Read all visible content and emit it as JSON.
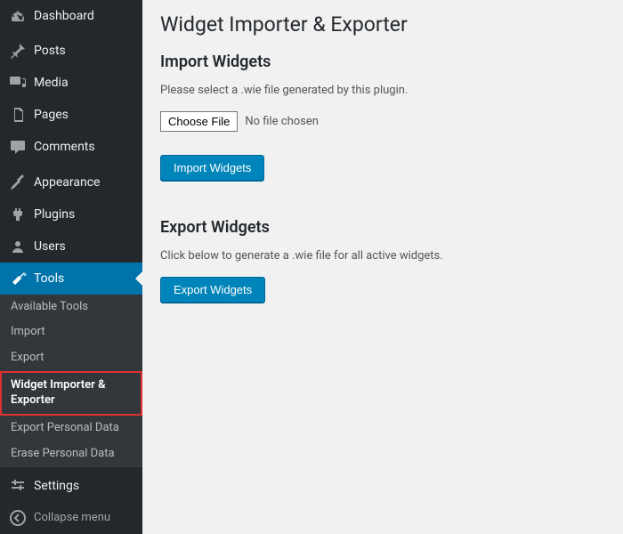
{
  "sidebar": {
    "items": [
      {
        "label": "Dashboard"
      },
      {
        "label": "Posts"
      },
      {
        "label": "Media"
      },
      {
        "label": "Pages"
      },
      {
        "label": "Comments"
      },
      {
        "label": "Appearance"
      },
      {
        "label": "Plugins"
      },
      {
        "label": "Users"
      },
      {
        "label": "Tools"
      },
      {
        "label": "Settings"
      }
    ],
    "tools_submenu": [
      {
        "label": "Available Tools"
      },
      {
        "label": "Import"
      },
      {
        "label": "Export"
      },
      {
        "label": "Widget Importer & Exporter"
      },
      {
        "label": "Export Personal Data"
      },
      {
        "label": "Erase Personal Data"
      }
    ],
    "collapse_label": "Collapse menu"
  },
  "page": {
    "title": "Widget Importer & Exporter",
    "import": {
      "heading": "Import Widgets",
      "instruction": "Please select a .wie file generated by this plugin.",
      "choose_file_label": "Choose File",
      "file_status": "No file chosen",
      "button": "Import Widgets"
    },
    "export": {
      "heading": "Export Widgets",
      "instruction": "Click below to generate a .wie file for all active widgets.",
      "button": "Export Widgets"
    }
  }
}
